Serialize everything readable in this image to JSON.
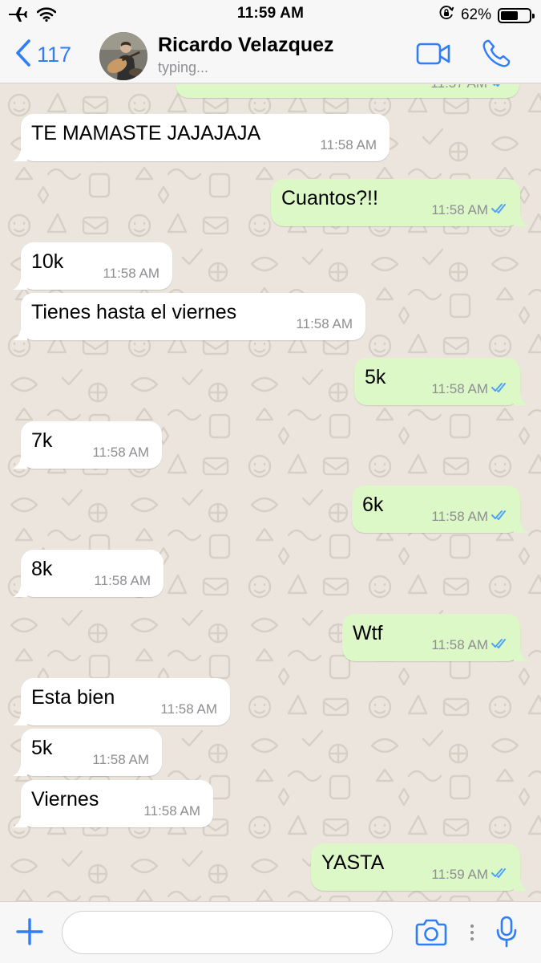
{
  "status_bar": {
    "time": "11:59 AM",
    "battery_percent_label": "62%",
    "battery_level": 0.62,
    "icons": [
      "airplane-icon",
      "wifi-icon",
      "orientation-lock-icon",
      "battery-icon"
    ]
  },
  "header": {
    "back_count": "117",
    "contact_name": "Ricardo Velazquez",
    "contact_status": "typing...",
    "icons": [
      "chevron-left-icon",
      "video-call-icon",
      "phone-call-icon"
    ]
  },
  "partial_top_message": {
    "time": "11:57 AM"
  },
  "messages": [
    {
      "direction": "in",
      "text": "TE MAMASTE JAJAJAJA",
      "time": "11:58 AM"
    },
    {
      "direction": "out",
      "text": "Cuantos?!!",
      "time": "11:58 AM",
      "status": "read"
    },
    {
      "direction": "in",
      "text": "10k",
      "time": "11:58 AM"
    },
    {
      "direction": "in",
      "text": "Tienes hasta el viernes",
      "time": "11:58 AM"
    },
    {
      "direction": "out",
      "text": "5k",
      "time": "11:58 AM",
      "status": "read"
    },
    {
      "direction": "in",
      "text": "7k",
      "time": "11:58 AM"
    },
    {
      "direction": "out",
      "text": "6k",
      "time": "11:58 AM",
      "status": "read"
    },
    {
      "direction": "in",
      "text": "8k",
      "time": "11:58 AM"
    },
    {
      "direction": "out",
      "text": "Wtf",
      "time": "11:58 AM",
      "status": "read"
    },
    {
      "direction": "in",
      "text": "Esta bien",
      "time": "11:58 AM"
    },
    {
      "direction": "in",
      "text": "5k",
      "time": "11:58 AM"
    },
    {
      "direction": "in",
      "text": "Viernes",
      "time": "11:58 AM"
    },
    {
      "direction": "out",
      "text": "YASTA",
      "time": "11:59 AM",
      "status": "read"
    }
  ],
  "input_bar": {
    "placeholder": "",
    "icons": [
      "plus-icon",
      "camera-icon",
      "more-dots-icon",
      "microphone-icon"
    ]
  },
  "colors": {
    "accent": "#2f7ef7",
    "incoming_bubble": "#ffffff",
    "outgoing_bubble": "#dcf8c6",
    "chat_background": "#ece5dd",
    "read_ticks": "#4fa3f7",
    "bar_background": "#f7f7f8"
  }
}
